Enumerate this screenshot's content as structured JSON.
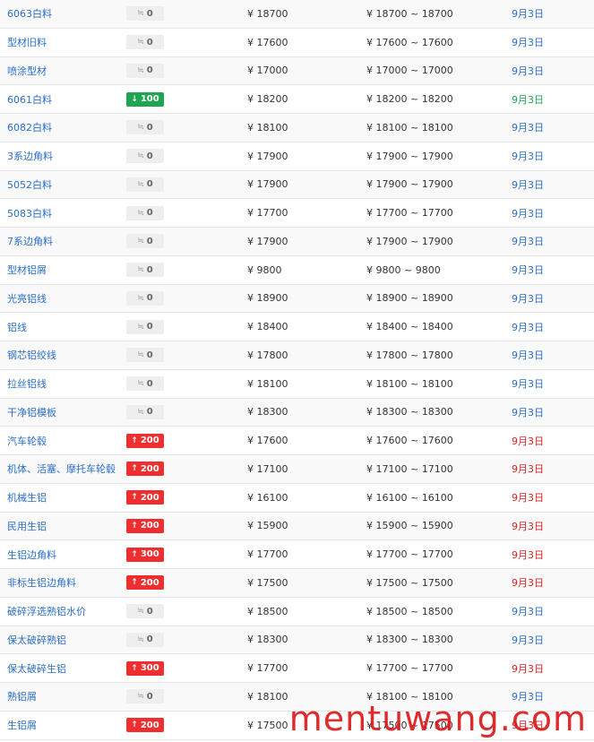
{
  "rows": [
    {
      "name": "6063白料",
      "change": "0",
      "dir": "flat",
      "price": "¥ 18700",
      "range": "¥ 18700 ~ 18700",
      "date": "9月3日"
    },
    {
      "name": "型材旧料",
      "change": "0",
      "dir": "flat",
      "price": "¥ 17600",
      "range": "¥ 17600 ~ 17600",
      "date": "9月3日"
    },
    {
      "name": "喷涂型材",
      "change": "0",
      "dir": "flat",
      "price": "¥ 17000",
      "range": "¥ 17000 ~ 17000",
      "date": "9月3日"
    },
    {
      "name": "6061白料",
      "change": "100",
      "dir": "down",
      "price": "¥ 18200",
      "range": "¥ 18200 ~ 18200",
      "date": "9月3日"
    },
    {
      "name": "6082白料",
      "change": "0",
      "dir": "flat",
      "price": "¥ 18100",
      "range": "¥ 18100 ~ 18100",
      "date": "9月3日"
    },
    {
      "name": "3系边角料",
      "change": "0",
      "dir": "flat",
      "price": "¥ 17900",
      "range": "¥ 17900 ~ 17900",
      "date": "9月3日"
    },
    {
      "name": "5052白料",
      "change": "0",
      "dir": "flat",
      "price": "¥ 17900",
      "range": "¥ 17900 ~ 17900",
      "date": "9月3日"
    },
    {
      "name": "5083白料",
      "change": "0",
      "dir": "flat",
      "price": "¥ 17700",
      "range": "¥ 17700 ~ 17700",
      "date": "9月3日"
    },
    {
      "name": "7系边角料",
      "change": "0",
      "dir": "flat",
      "price": "¥ 17900",
      "range": "¥ 17900 ~ 17900",
      "date": "9月3日"
    },
    {
      "name": "型材铝屑",
      "change": "0",
      "dir": "flat",
      "price": "¥ 9800",
      "range": "¥ 9800 ~ 9800",
      "date": "9月3日"
    },
    {
      "name": "光亮铝线",
      "change": "0",
      "dir": "flat",
      "price": "¥ 18900",
      "range": "¥ 18900 ~ 18900",
      "date": "9月3日"
    },
    {
      "name": "铝线",
      "change": "0",
      "dir": "flat",
      "price": "¥ 18400",
      "range": "¥ 18400 ~ 18400",
      "date": "9月3日"
    },
    {
      "name": "钢芯铝绞线",
      "change": "0",
      "dir": "flat",
      "price": "¥ 17800",
      "range": "¥ 17800 ~ 17800",
      "date": "9月3日"
    },
    {
      "name": "拉丝铝线",
      "change": "0",
      "dir": "flat",
      "price": "¥ 18100",
      "range": "¥ 18100 ~ 18100",
      "date": "9月3日"
    },
    {
      "name": "干净铝模板",
      "change": "0",
      "dir": "flat",
      "price": "¥ 18300",
      "range": "¥ 18300 ~ 18300",
      "date": "9月3日"
    },
    {
      "name": "汽车轮毂",
      "change": "200",
      "dir": "up",
      "price": "¥ 17600",
      "range": "¥ 17600 ~ 17600",
      "date": "9月3日"
    },
    {
      "name": "机体、活塞、摩托车轮毂",
      "change": "200",
      "dir": "up",
      "price": "¥ 17100",
      "range": "¥ 17100 ~ 17100",
      "date": "9月3日"
    },
    {
      "name": "机械生铝",
      "change": "200",
      "dir": "up",
      "price": "¥ 16100",
      "range": "¥ 16100 ~ 16100",
      "date": "9月3日"
    },
    {
      "name": "民用生铝",
      "change": "200",
      "dir": "up",
      "price": "¥ 15900",
      "range": "¥ 15900 ~ 15900",
      "date": "9月3日"
    },
    {
      "name": "生铝边角料",
      "change": "300",
      "dir": "up",
      "price": "¥ 17700",
      "range": "¥ 17700 ~ 17700",
      "date": "9月3日"
    },
    {
      "name": "非标生铝边角料",
      "change": "200",
      "dir": "up",
      "price": "¥ 17500",
      "range": "¥ 17500 ~ 17500",
      "date": "9月3日"
    },
    {
      "name": "破碎浮选熟铝水价",
      "change": "0",
      "dir": "flat",
      "price": "¥ 18500",
      "range": "¥ 18500 ~ 18500",
      "date": "9月3日"
    },
    {
      "name": "保太破碎熟铝",
      "change": "0",
      "dir": "flat",
      "price": "¥ 18300",
      "range": "¥ 18300 ~ 18300",
      "date": "9月3日"
    },
    {
      "name": "保太破碎生铝",
      "change": "300",
      "dir": "up",
      "price": "¥ 17700",
      "range": "¥ 17700 ~ 17700",
      "date": "9月3日"
    },
    {
      "name": "熟铝屑",
      "change": "0",
      "dir": "flat",
      "price": "¥ 18100",
      "range": "¥ 18100 ~ 18100",
      "date": "9月3日"
    },
    {
      "name": "生铝屑",
      "change": "200",
      "dir": "up",
      "price": "¥ 17500",
      "range": "¥ 17500 ~ 17500",
      "date": "9月3日"
    }
  ],
  "arrows": {
    "flat": "≒",
    "up": "↑",
    "down": "↓"
  },
  "watermark": "mentuwang.com",
  "colors": {
    "up": "#ef2f2f",
    "down": "#1fa552",
    "flat_link": "#2a6fc9"
  }
}
